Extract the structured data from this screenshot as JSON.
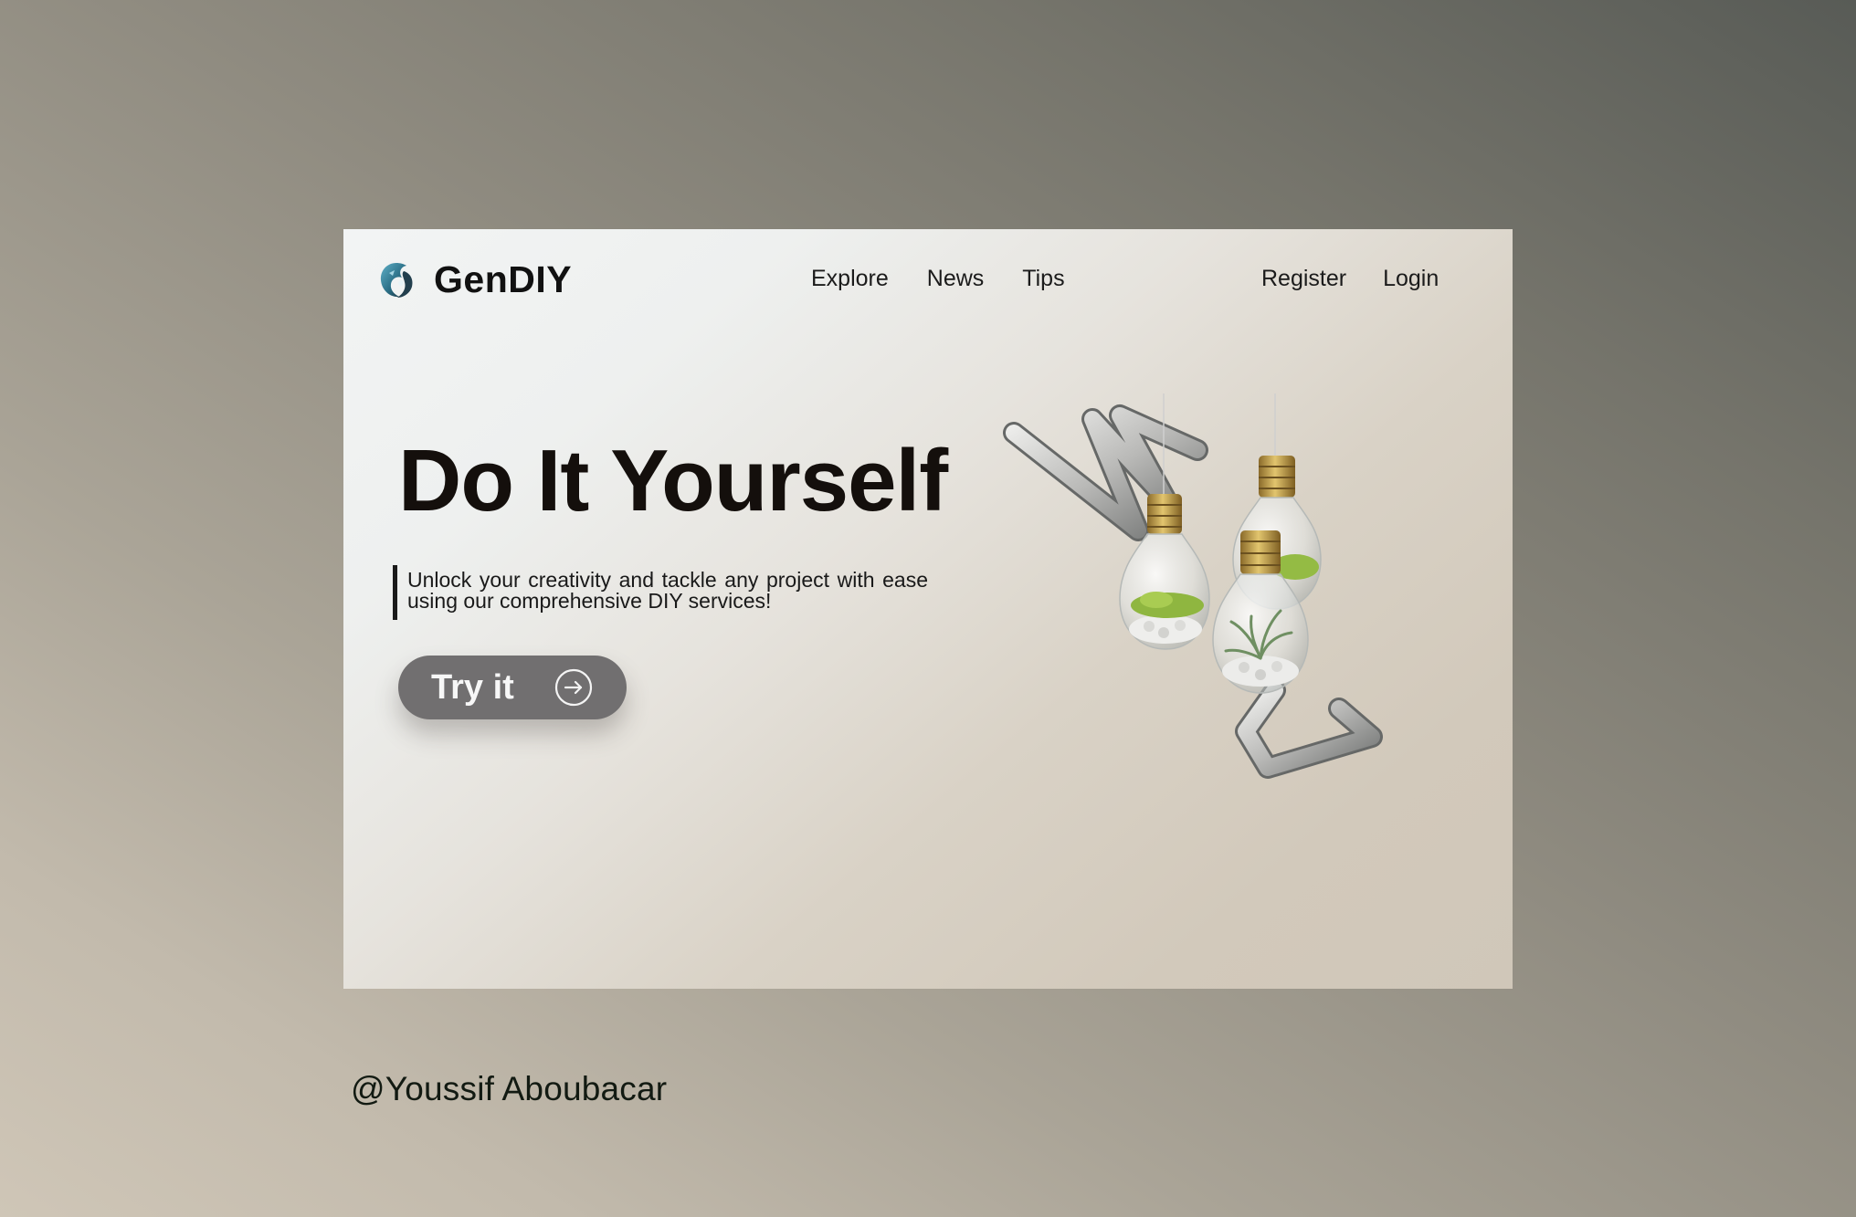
{
  "brand": {
    "name": "GenDIY",
    "logo_icon": "dragon-logo-icon"
  },
  "nav": {
    "items": [
      {
        "label": "Explore"
      },
      {
        "label": "News"
      },
      {
        "label": "Tips"
      }
    ]
  },
  "auth": {
    "register_label": "Register",
    "login_label": "Login"
  },
  "hero": {
    "title": "Do It Yourself",
    "description": "Unlock your creativity and tackle any project with ease using our comprehensive DIY services!",
    "cta_label": "Try it",
    "cta_icon": "arrow-right-circle-icon"
  },
  "illustration": {
    "subject": "lightbulb-terrarium-image"
  },
  "credit": {
    "text": "@Youssif Aboubacar"
  },
  "colors": {
    "button_bg": "#716f70",
    "title_text": "#140f0c",
    "credit_text": "#121a12"
  }
}
